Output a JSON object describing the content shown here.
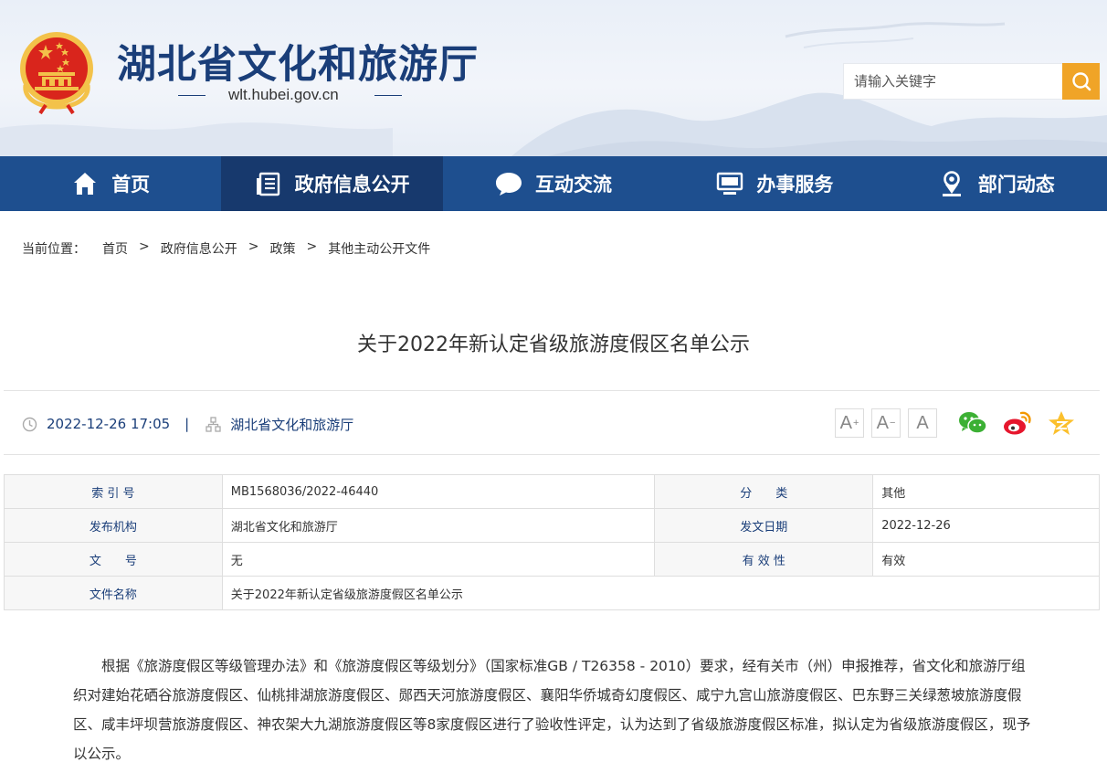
{
  "site": {
    "title": "湖北省文化和旅游厅",
    "url": "wlt.hubei.gov.cn",
    "search_placeholder": "请输入关键字"
  },
  "nav": {
    "items": [
      {
        "label": "首页",
        "icon": "home-icon",
        "active": false
      },
      {
        "label": "政府信息公开",
        "icon": "document-list-icon",
        "active": true
      },
      {
        "label": "互动交流",
        "icon": "chat-bubble-icon",
        "active": false
      },
      {
        "label": "办事服务",
        "icon": "monitor-icon",
        "active": false
      },
      {
        "label": "部门动态",
        "icon": "location-pin-icon",
        "active": false
      }
    ]
  },
  "breadcrumb": {
    "lead": "当前位置：",
    "sep": ">",
    "items": [
      "首页",
      "政府信息公开",
      "政策",
      "其他主动公开文件"
    ]
  },
  "article": {
    "title": "关于2022年新认定省级旅游度假区名单公示",
    "datetime": "2022-12-26 17:05",
    "divider": "|",
    "publisher": "湖北省文化和旅游厅",
    "font_buttons": [
      "A",
      "A",
      "A"
    ],
    "share": [
      "wechat-icon",
      "weibo-icon",
      "qzone-icon"
    ]
  },
  "info": {
    "index_label": "索 引 号",
    "index_value": "MB1568036/2022-46440",
    "category_label": "分　　类",
    "category_value": "其他",
    "org_label": "发布机构",
    "org_value": "湖北省文化和旅游厅",
    "date_label": "发文日期",
    "date_value": "2022-12-26",
    "docno_label": "文　　号",
    "docno_value": "无",
    "validity_label": "有 效 性",
    "validity_value": "有效",
    "name_label": "文件名称",
    "name_value": "关于2022年新认定省级旅游度假区名单公示"
  },
  "body": {
    "paragraph": "根据《旅游度假区等级管理办法》和《旅游度假区等级划分》（国家标准GB / T26358 - 2010）要求，经有关市（州）申报推荐，省文化和旅游厅组织对建始花硒谷旅游度假区、仙桃排湖旅游度假区、郧西天河旅游度假区、襄阳华侨城奇幻度假区、咸宁九宫山旅游度假区、巴东野三关绿葱坡旅游度假区、咸丰坪坝营旅游度假区、神农架大九湖旅游度假区等8家度假区进行了验收性评定，认为达到了省级旅游度假区标准，拟认定为省级旅游度假区，现予以公示。"
  },
  "colors": {
    "nav_bg": "#1e4f8f",
    "nav_active": "#17396d",
    "title_blue": "#1a3e79",
    "search_btn": "#f0a427",
    "emblem_red": "#d9251c",
    "emblem_gold": "#f3c24a"
  }
}
